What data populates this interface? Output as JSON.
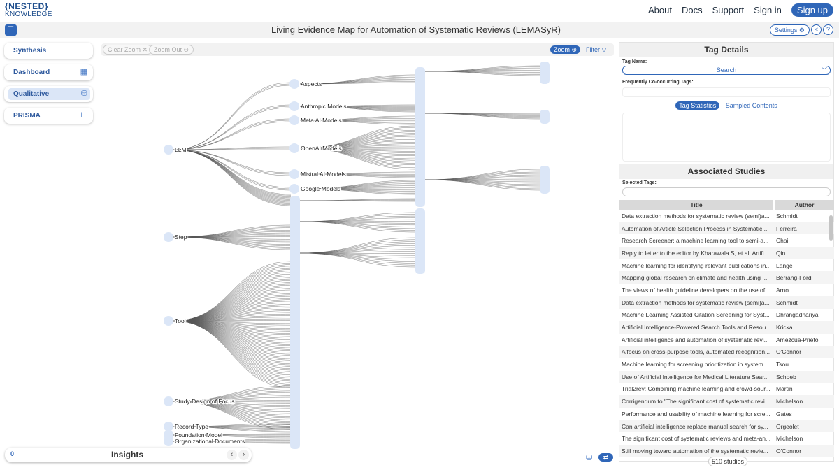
{
  "header": {
    "logo_line1": "{NESTED}",
    "logo_line2": "KNOWLEDGE",
    "nav": {
      "about": "About",
      "docs": "Docs",
      "support": "Support",
      "sign_in": "Sign in",
      "sign_up": "Sign up"
    },
    "menu_icon": "hamburger-icon",
    "title": "Living Evidence Map for Automation of Systematic Reviews (LEMASyR)",
    "settings_label": "Settings",
    "share_icon": "share-icon",
    "help_icon": "help-icon"
  },
  "sidebar": {
    "items": [
      {
        "label": "Synthesis",
        "icon": "",
        "active": false
      },
      {
        "label": "Dashboard",
        "icon": "dashboard-icon",
        "active": false
      },
      {
        "label": "Qualitative",
        "icon": "qualitative-icon",
        "active": true
      },
      {
        "label": "PRISMA",
        "icon": "prisma-icon",
        "active": false
      }
    ]
  },
  "graph_toolbar": {
    "clear_zoom": "Clear Zoom",
    "zoom_out": "Zoom Out",
    "zoom": "Zoom",
    "filter": "Filter"
  },
  "graph": {
    "root_nodes": [
      "LLM",
      "Step",
      "Tool",
      "Study Design of Focus",
      "Record Type",
      "Foundation Model",
      "Organizational Documents"
    ],
    "llm_children": [
      "Aspects",
      "Anthropic Models",
      "Meta AI Models",
      "OpenAI Models",
      "Mistral AI Models",
      "Google Models"
    ],
    "node_color": "#dbe6f7",
    "edge_color": "#555555"
  },
  "insights": {
    "count": "0",
    "title": "Insights"
  },
  "tag_details": {
    "title": "Tag Details",
    "tag_name_label": "Tag Name:",
    "search_placeholder": "Search",
    "cooccurring_label": "Frequently Co-occurring Tags:",
    "tab_statistics": "Tag Statistics",
    "tab_sampled": "Sampled Contents"
  },
  "associated": {
    "title": "Associated Studies",
    "selected_tags_label": "Selected Tags:",
    "columns": [
      "Title",
      "Author"
    ],
    "rows": [
      [
        "Data extraction methods for systematic review (semi)a...",
        "Schmidt"
      ],
      [
        "Automation of Article Selection Process in Systematic ...",
        "Ferreira"
      ],
      [
        "Research Screener: a machine learning tool to semi-a...",
        "Chai"
      ],
      [
        "Reply to letter to the editor by Kharawala S, et al: Artifi...",
        "Qin"
      ],
      [
        "Machine learning for identifying relevant publications in...",
        "Lange"
      ],
      [
        "Mapping global research on climate and health using ...",
        "Berrang-Ford"
      ],
      [
        "The views of health guideline developers on the use of...",
        "Arno"
      ],
      [
        "Data extraction methods for systematic review (semi)a...",
        "Schmidt"
      ],
      [
        "Machine Learning Assisted Citation Screening for Syst...",
        "Dhrangadhariya"
      ],
      [
        "Artificial Intelligence-Powered Search Tools and Resou...",
        "Kricka"
      ],
      [
        "Artificial intelligence and automation of systematic revi...",
        "Amezcua-Prieto"
      ],
      [
        "A focus on cross-purpose tools, automated recognition...",
        "O'Connor"
      ],
      [
        "Machine learning for screening prioritization in system...",
        "Tsou"
      ],
      [
        "Use of Artificial Intelligence for Medical Literature Sear...",
        "Schoeb"
      ],
      [
        "Trial2rev: Combining machine learning and crowd-sour...",
        "Martin"
      ],
      [
        "Corrigendum to \"The significant cost of systematic revi...",
        "Michelson"
      ],
      [
        "Performance and usability of machine learning for scre...",
        "Gates"
      ],
      [
        "Can artificial intelligence replace manual search for sy...",
        "Orgeolet"
      ],
      [
        "The significant cost of systematic reviews and meta-an...",
        "Michelson"
      ],
      [
        "Still moving toward automation of the systematic revie...",
        "O'Connor"
      ]
    ],
    "study_count": "510 studies"
  },
  "colors": {
    "accent": "#2f66b8",
    "node": "#dbe6f7"
  }
}
